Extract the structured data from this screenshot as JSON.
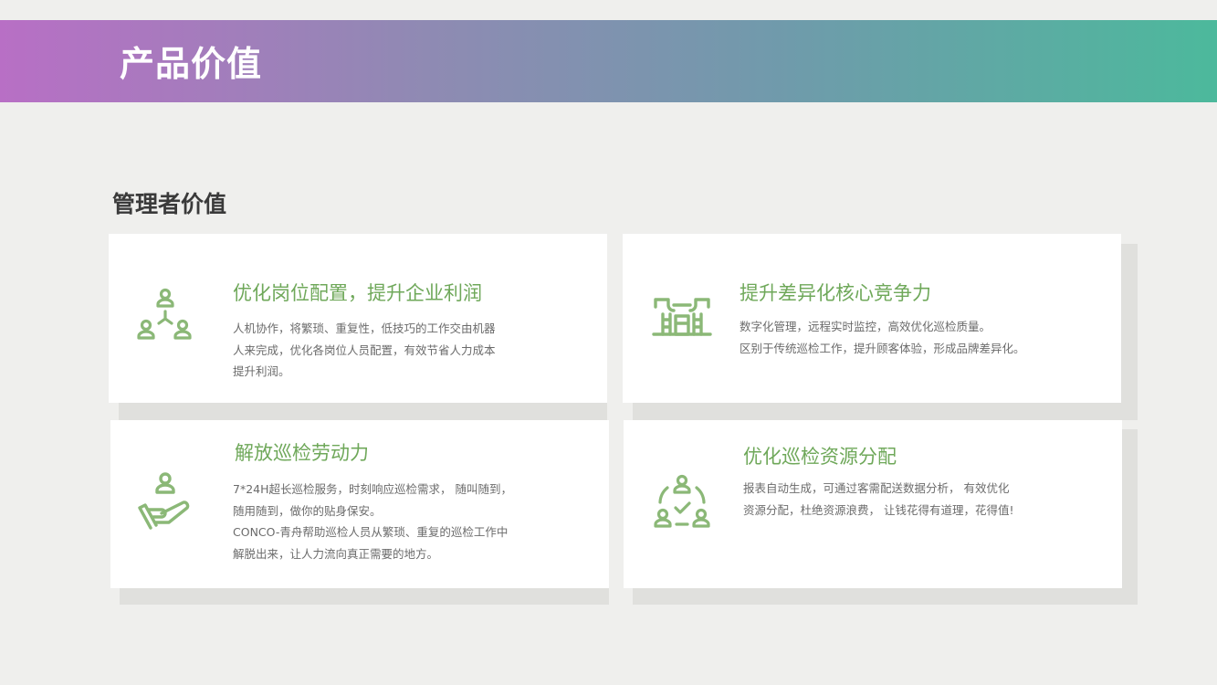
{
  "header": {
    "title": "产品价值"
  },
  "section": {
    "title": "管理者价值"
  },
  "cards": [
    {
      "icon": "people-network-icon",
      "title": "优化岗位配置，提升企业利润",
      "lines": [
        "人机协作，将繁琐、重复性，低技巧的工作交由机器",
        "人来完成，优化各岗位人员配置，有效节省人力成本",
        "提升利润。"
      ]
    },
    {
      "icon": "data-server-icon",
      "title": "提升差异化核心竞争力",
      "lines": [
        "数字化管理，远程实时监控，高效优化巡检质量。",
        "区别于传统巡检工作，提升顾客体验，形成品牌差异化。"
      ]
    },
    {
      "icon": "hand-person-icon",
      "title": "解放巡检劳动力",
      "lines": [
        "7*24H超长巡检服务，时刻响应巡检需求，  随叫随到，",
        "随用随到，做你的贴身保安。",
        "CONCO-青舟帮助巡检人员从繁琐、重复的巡检工作中",
        "解脱出来，让人力流向真正需要的地方。"
      ]
    },
    {
      "icon": "team-check-icon",
      "title": "优化巡检资源分配",
      "lines": [
        "报表自动生成，可通过客需配送数据分析，  有效优化",
        "资源分配，杜绝资源浪费，  让钱花得有道理，花得值!"
      ]
    }
  ],
  "colors": {
    "accent_green": "#6fa85a",
    "icon_green": "#8bb877",
    "banner_start": "#b86fc5",
    "banner_end": "#4cb99c"
  }
}
